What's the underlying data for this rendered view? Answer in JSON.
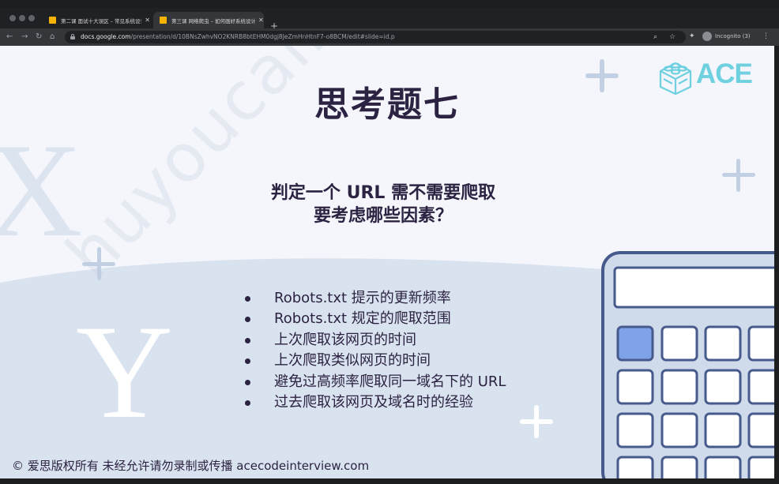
{
  "browser": {
    "tabs": [
      {
        "title": "第二课 面试十大误区 – 常见系统设计..."
      },
      {
        "title": "第三课 网络爬虫 – 如何画好系统设计..."
      }
    ],
    "url_domain": "docs.google.com",
    "url_path": "/presentation/d/10BNsZwhvNO2KNRB8btEHM0dgj8JeZmHnHtnF7-o8BCM/edit#slide=id.p",
    "incognito_label": "Incognito (3)"
  },
  "slide": {
    "title": "思考题七",
    "question_line1": "判定一个 URL 需不需要爬取",
    "question_line2": "要考虑哪些因素？",
    "bullets": [
      "Robots.txt 提示的更新频率",
      "Robots.txt 规定的爬取范围",
      "上次爬取该网页的时间",
      "上次爬取类似网页的时间",
      "避免过高频率爬取同一域名下的 URL",
      "过去爬取该网页及域名时的经验"
    ],
    "footer": "© 爱思版权所有 未经允许请勿录制或传播 acecodeinterview.com",
    "logo_text": "ACE",
    "watermark": "huyoucai.huxin",
    "bg_letters": [
      "X",
      "Y"
    ]
  },
  "colors": {
    "text_dark": "#2c2342",
    "accent_cyan": "#6fd0e0",
    "calc_key_highlight": "#7ea3e8",
    "calc_frame": "#465a8c"
  }
}
